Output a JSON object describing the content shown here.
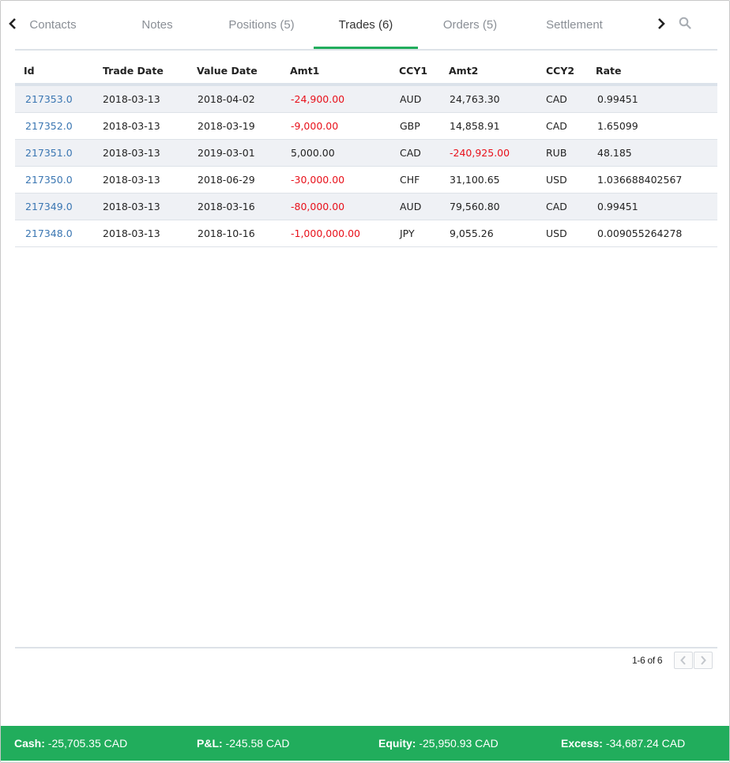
{
  "tabs": {
    "items": [
      {
        "label": "Contacts"
      },
      {
        "label": "Notes"
      },
      {
        "label": "Positions (5)"
      },
      {
        "label": "Trades (6)"
      },
      {
        "label": "Orders (5)"
      },
      {
        "label": "Settlement"
      }
    ],
    "active": "Trades (6)"
  },
  "table": {
    "headers": {
      "id": "Id",
      "trade_date": "Trade Date",
      "value_date": "Value Date",
      "amt1": "Amt1",
      "ccy1": "CCY1",
      "amt2": "Amt2",
      "ccy2": "CCY2",
      "rate": "Rate"
    },
    "rows": [
      {
        "id": "217353.0",
        "trade_date": "2018-03-13",
        "value_date": "2018-04-02",
        "amt1": "-24,900.00",
        "ccy1": "AUD",
        "amt2": "24,763.30",
        "ccy2": "CAD",
        "rate": "0.99451"
      },
      {
        "id": "217352.0",
        "trade_date": "2018-03-13",
        "value_date": "2018-03-19",
        "amt1": "-9,000.00",
        "ccy1": "GBP",
        "amt2": "14,858.91",
        "ccy2": "CAD",
        "rate": "1.65099"
      },
      {
        "id": "217351.0",
        "trade_date": "2018-03-13",
        "value_date": "2019-03-01",
        "amt1": "5,000.00",
        "ccy1": "CAD",
        "amt2": "-240,925.00",
        "ccy2": "RUB",
        "rate": "48.185"
      },
      {
        "id": "217350.0",
        "trade_date": "2018-03-13",
        "value_date": "2018-06-29",
        "amt1": "-30,000.00",
        "ccy1": "CHF",
        "amt2": "31,100.65",
        "ccy2": "USD",
        "rate": "1.036688402567"
      },
      {
        "id": "217349.0",
        "trade_date": "2018-03-13",
        "value_date": "2018-03-16",
        "amt1": "-80,000.00",
        "ccy1": "AUD",
        "amt2": "79,560.80",
        "ccy2": "CAD",
        "rate": "0.99451"
      },
      {
        "id": "217348.0",
        "trade_date": "2018-03-13",
        "value_date": "2018-10-16",
        "amt1": "-1,000,000.00",
        "ccy1": "JPY",
        "amt2": "9,055.26",
        "ccy2": "USD",
        "rate": "0.009055264278"
      }
    ]
  },
  "pager": {
    "text": "1-6 of 6"
  },
  "footer": {
    "cash_label": "Cash:",
    "cash_value": " -25,705.35 CAD",
    "pl_label": "P&L:",
    "pl_value": " -245.58 CAD",
    "equity_label": "Equity:",
    "equity_value": " -25,950.93 CAD",
    "excess_label": "Excess:",
    "excess_value": " -34,687.24 CAD"
  },
  "colors": {
    "accent": "#21ad5c",
    "link": "#3a76b2",
    "negative": "#e8101a",
    "row_stripe": "#eff1f5"
  },
  "icons": [
    "chevron-left-icon",
    "chevron-right-icon",
    "search-icon",
    "pager-prev-icon",
    "pager-next-icon"
  ]
}
